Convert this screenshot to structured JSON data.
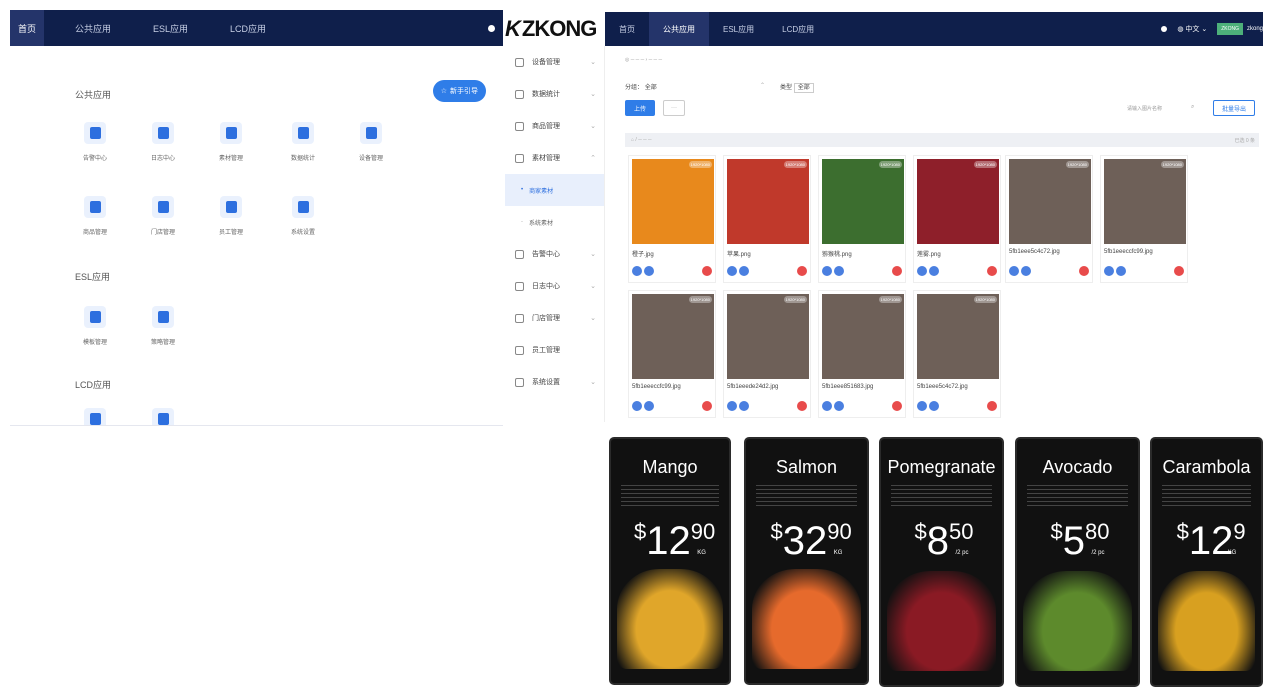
{
  "left_panel": {
    "nav": [
      "首页",
      "公共应用",
      "ESL应用",
      "LCD应用"
    ],
    "sections": [
      "公共应用",
      "ESL应用",
      "LCD应用"
    ],
    "guide_button": "新手引导",
    "public_apps": [
      "告警中心",
      "日志中心",
      "素材管理",
      "数据统计",
      "设备管理",
      "商品管理",
      "门店管理",
      "员工管理",
      "系统设置"
    ],
    "esl_apps": [
      "模板管理",
      "策略管理"
    ]
  },
  "logo": {
    "text": "ZKONG"
  },
  "sidebar": {
    "items": [
      "设备管理",
      "数据统计",
      "商品管理",
      "素材管理",
      "告警中心",
      "日志中心",
      "门店管理",
      "员工管理",
      "系统设置"
    ],
    "sub_items": [
      "商家素材",
      "系统素材"
    ]
  },
  "right_panel": {
    "nav": [
      "首页",
      "公共应用",
      "ESL应用",
      "LCD应用"
    ],
    "language": "中文",
    "user_badge": "ZKONG",
    "user": "zkong",
    "filter_label": "分组：",
    "filter_value": "全部",
    "type_label": "类型",
    "type_value": "全部",
    "upload": "上传",
    "more": "···",
    "search_placeholder": "请输入图片名称",
    "export": "批量导出",
    "count": "已选 0 条",
    "cards": [
      {
        "name": "橙子.jpg",
        "size": "1920*1080",
        "color": "#e8891c"
      },
      {
        "name": "苹果.png",
        "size": "1920*1080",
        "color": "#c0392b"
      },
      {
        "name": "猕猴桃.png",
        "size": "1920*1080",
        "color": "#3c6e2f"
      },
      {
        "name": "莲雾.png",
        "size": "1920*1080",
        "color": "#8e1f2a"
      },
      {
        "name": "5fb1eee5c4c72.jpg",
        "size": "1920*1080",
        "color": "#6e6058"
      },
      {
        "name": "5fb1eeeccfc99.jpg",
        "size": "1920*1080",
        "color": "#6e6058"
      },
      {
        "name": "5fb1eeeccfc99.jpg",
        "size": "1920*1080",
        "color": "#6e6058"
      },
      {
        "name": "5fb1eeede24d2.jpg",
        "size": "1920*1080",
        "color": "#6e6058"
      },
      {
        "name": "5fb1eee851683.jpg",
        "size": "1920*1080",
        "color": "#6e6058"
      },
      {
        "name": "5fb1eee5c4c72.jpg",
        "size": "1920*1080",
        "color": "#6e6058"
      }
    ]
  },
  "displays": [
    {
      "title": "Mango",
      "whole": "12",
      "cents": "90",
      "unit": "KG",
      "color": "#e0a62a"
    },
    {
      "title": "Salmon",
      "whole": "32",
      "cents": "90",
      "unit": "KG",
      "color": "#e66a2c"
    },
    {
      "title": "Pomegranate",
      "whole": "8",
      "cents": "50",
      "unit": "/2 pc",
      "color": "#8a1a24"
    },
    {
      "title": "Avocado",
      "whole": "5",
      "cents": "80",
      "unit": "/2 pc",
      "color": "#5d8a2c"
    },
    {
      "title": "Carambola",
      "whole": "12",
      "cents": "9",
      "unit": "KG",
      "color": "#d8a020"
    }
  ]
}
